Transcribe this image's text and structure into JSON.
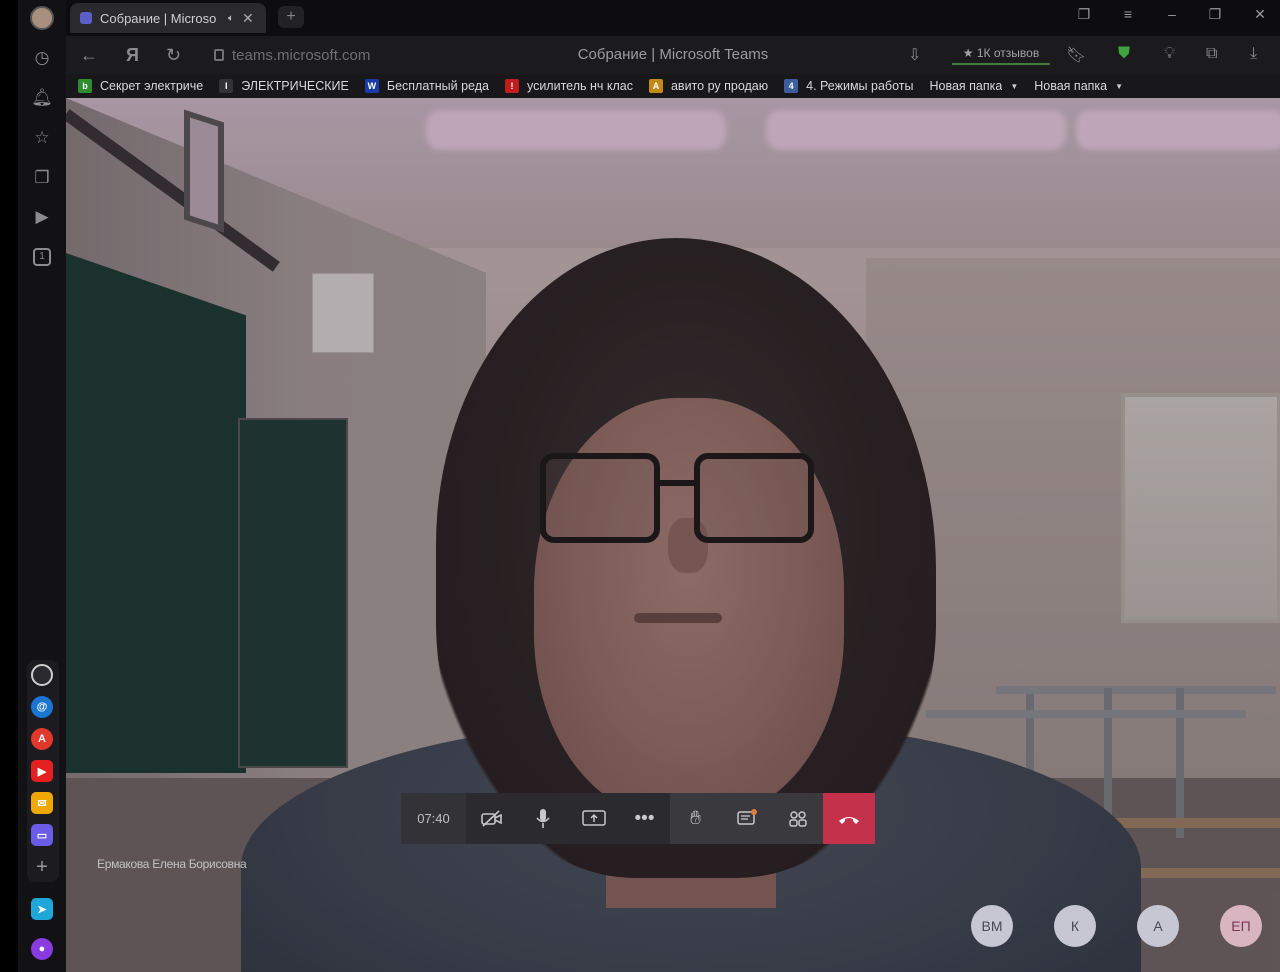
{
  "browser": {
    "tab": {
      "title": "Собрание | Microso",
      "favicon": "teams-icon"
    },
    "address": {
      "url": "teams.microsoft.com",
      "page_title": "Собрание | Microsoft Teams",
      "reviews": "★ 1К отзывов"
    }
  },
  "bookmarks": [
    {
      "label": "Секрет электриче",
      "color": "#2e8b2e",
      "glyph": "b"
    },
    {
      "label": "ЭЛЕКТРИЧЕСКИЕ",
      "color": "#333333",
      "glyph": "I"
    },
    {
      "label": "Бесплатный реда",
      "color": "#1a3aa8",
      "glyph": "W"
    },
    {
      "label": "усилитель нч клас",
      "color": "#c21d1d",
      "glyph": "!"
    },
    {
      "label": "авито ру продаю",
      "color": "#c28a12",
      "glyph": "A"
    },
    {
      "label": "4. Режимы работы",
      "color": "#3c5d9e",
      "glyph": "4"
    },
    {
      "label": "Новая папка",
      "folder": true
    },
    {
      "label": "Новая папка",
      "folder": true
    }
  ],
  "meeting": {
    "timer": "07:40",
    "caller_name": "Ермакова Елена Борисовна",
    "participants": [
      "ВМ",
      "К",
      "А",
      "ЕП"
    ]
  },
  "colors": {
    "hangup": "#c4314b",
    "teams_accent": "#5b5fc7",
    "shield": "#3fa33f"
  }
}
